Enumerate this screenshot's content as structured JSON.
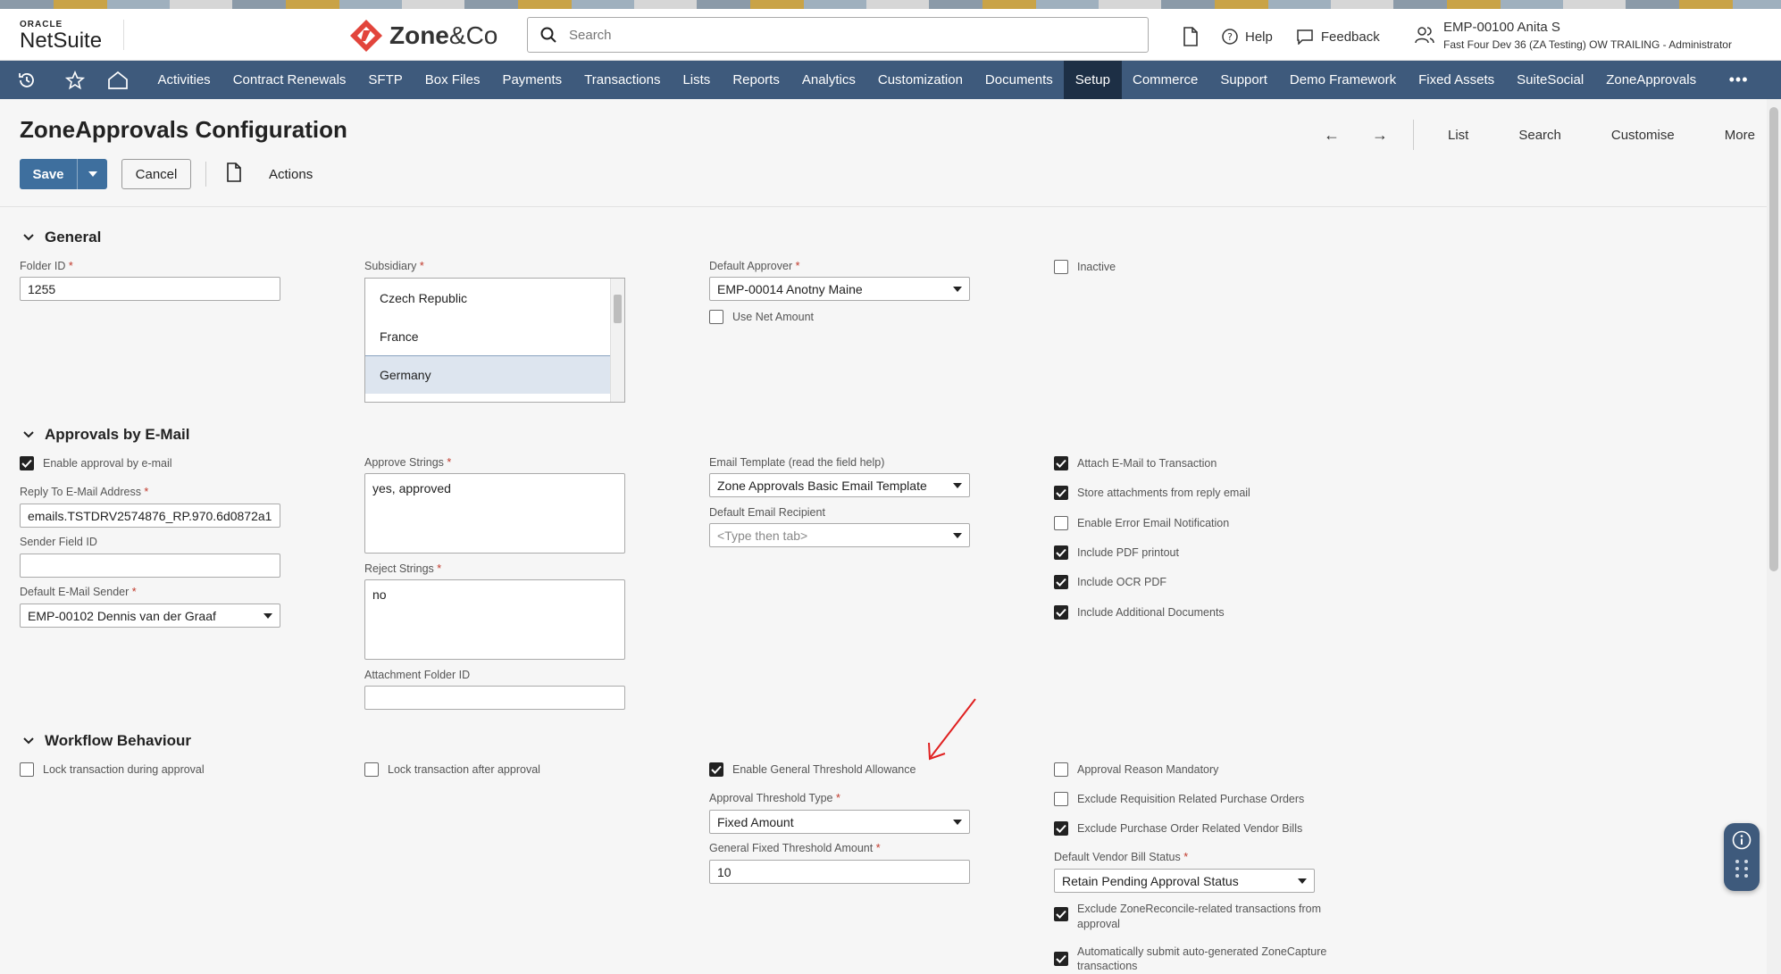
{
  "header": {
    "logo_top": "ORACLE",
    "logo_main": "NetSuite",
    "brand_name": "Zone",
    "brand_suffix": "&Co",
    "search_placeholder": "Search",
    "help_label": "Help",
    "feedback_label": "Feedback",
    "user_name": "EMP-00100 Anita S",
    "user_role": "Fast Four Dev 36 (ZA Testing) OW TRAILING - Administrator"
  },
  "nav": {
    "items": [
      "Activities",
      "Contract Renewals",
      "SFTP",
      "Box Files",
      "Payments",
      "Transactions",
      "Lists",
      "Reports",
      "Analytics",
      "Customization",
      "Documents",
      "Setup",
      "Commerce",
      "Support",
      "Demo Framework",
      "Fixed Assets",
      "SuiteSocial",
      "ZoneApprovals"
    ],
    "active": "Setup",
    "more": "•••"
  },
  "page": {
    "title": "ZoneApprovals Configuration",
    "back_arrow": "←",
    "forward_arrow": "→",
    "links": [
      "List",
      "Search",
      "Customise",
      "More"
    ],
    "save_label": "Save",
    "cancel_label": "Cancel",
    "actions_label": "Actions"
  },
  "general": {
    "heading": "General",
    "folder_id_label": "Folder ID",
    "folder_id_value": "1255",
    "subsidiary_label": "Subsidiary",
    "subsidiary_options": [
      "Czech Republic",
      "France",
      "Germany"
    ],
    "subsidiary_selected": "Germany",
    "default_approver_label": "Default Approver",
    "default_approver_value": "EMP-00014 Anotny Maine",
    "use_net_amount_label": "Use Net Amount",
    "use_net_amount": false,
    "inactive_label": "Inactive",
    "inactive": false
  },
  "email": {
    "heading": "Approvals by E-Mail",
    "enable_label": "Enable approval by e-mail",
    "enable": true,
    "reply_to_label": "Reply To E-Mail Address",
    "reply_to_value": "emails.TSTDRV2574876_RP.970.6d0872a1",
    "sender_field_label": "Sender Field ID",
    "sender_field_value": "",
    "default_sender_label": "Default E-Mail Sender",
    "default_sender_value": "EMP-00102 Dennis van der Graaf",
    "approve_strings_label": "Approve Strings",
    "approve_strings_value": "yes, approved",
    "reject_strings_label": "Reject Strings",
    "reject_strings_value": "no",
    "attachment_folder_label": "Attachment Folder ID",
    "attachment_folder_value": "",
    "template_label": "Email Template (read the field help)",
    "template_value": "Zone Approvals Basic Email Template",
    "recipient_label": "Default Email Recipient",
    "recipient_placeholder": "<Type then tab>",
    "checks": [
      {
        "label": "Attach E-Mail to Transaction",
        "on": true
      },
      {
        "label": "Store attachments from reply email",
        "on": true
      },
      {
        "label": "Enable Error Email Notification",
        "on": false
      },
      {
        "label": "Include PDF printout",
        "on": true
      },
      {
        "label": "Include OCR PDF",
        "on": true
      },
      {
        "label": "Include Additional Documents",
        "on": true
      }
    ]
  },
  "workflow": {
    "heading": "Workflow Behaviour",
    "lock_during_label": "Lock transaction during approval",
    "lock_during": false,
    "lock_after_label": "Lock transaction after approval",
    "lock_after": false,
    "threshold_allow_label": "Enable General Threshold Allowance",
    "threshold_allow": true,
    "threshold_type_label": "Approval Threshold Type",
    "threshold_type_value": "Fixed Amount",
    "fixed_amount_label": "General Fixed Threshold Amount",
    "fixed_amount_value": "10",
    "reason_mandatory_label": "Approval Reason Mandatory",
    "reason_mandatory": false,
    "exclude_req_label": "Exclude Requisition Related Purchase Orders",
    "exclude_req": false,
    "exclude_po_label": "Exclude Purchase Order Related Vendor Bills",
    "exclude_po": true,
    "vendor_bill_status_label": "Default Vendor Bill Status",
    "vendor_bill_status_value": "Retain Pending Approval Status",
    "exclude_zr_label_1": "Exclude ZoneReconcile-related transactions from",
    "exclude_zr_label_2": "approval",
    "exclude_zr": true,
    "auto_submit_label_1": "Automatically submit auto-generated ZoneCapture",
    "auto_submit_label_2": "transactions",
    "auto_submit": true
  },
  "colors": {
    "nav_bg": "#3e5a7c",
    "nav_active": "#1d2f45",
    "primary_button": "#3e6f9e",
    "brand_red": "#e2453c",
    "annotation_arrow": "#e02020"
  }
}
